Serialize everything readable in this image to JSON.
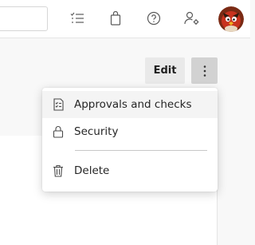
{
  "header": {
    "search_value": "",
    "icons": [
      "task-list-icon",
      "shopping-bag-icon",
      "help-icon",
      "user-settings-icon"
    ],
    "avatar": "profile-avatar"
  },
  "toolbar": {
    "edit_label": "Edit",
    "more_icon": "more-vertical-icon"
  },
  "menu": {
    "items": [
      {
        "label": "Approvals and checks",
        "icon": "checklist-icon"
      },
      {
        "label": "Security",
        "icon": "lock-icon"
      },
      {
        "label": "Delete",
        "icon": "trash-icon"
      }
    ]
  },
  "colors": {
    "header_bg": "#ffffff",
    "page_bg": "#f8f8f8",
    "edit_bg": "#e9e9e9",
    "more_bg": "#d2d2d2",
    "menu_hover": "#f4f4f4",
    "text": "#262626"
  }
}
